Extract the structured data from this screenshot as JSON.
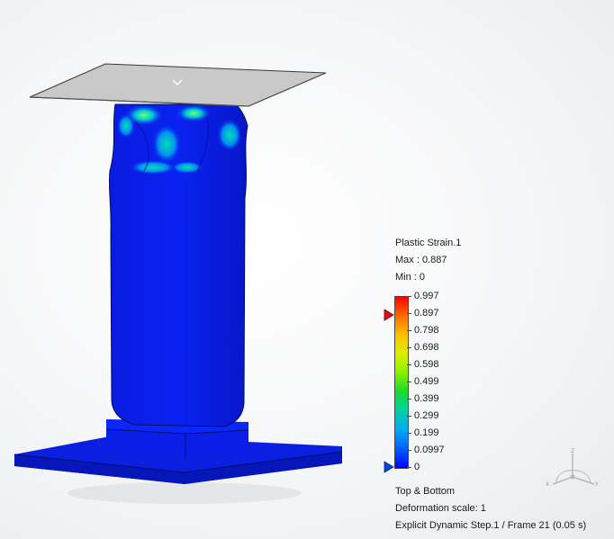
{
  "legend": {
    "title": "Plastic Strain.1",
    "max_text": "Max : 0.887",
    "min_text": "Min : 0",
    "ticks": [
      "0.997",
      "0.897",
      "0.798",
      "0.698",
      "0.598",
      "0.499",
      "0.399",
      "0.299",
      "0.199",
      "0.0997",
      "0"
    ],
    "max_marker_color": "#e01010",
    "min_marker_color": "#1040e0"
  },
  "info": {
    "plot_label": "Top & Bottom",
    "deformation_scale": "Deformation scale: 1",
    "step_frame": "Explicit Dynamic Step.1 / Frame 21 (0.05 s)"
  },
  "triad": {
    "axis_x": "X",
    "axis_y": "Y",
    "axis_z": "Z"
  },
  "colors": {
    "model_blue": "#0a1ee8",
    "plate_gray": "#c7c7c7",
    "base_blue": "#0a1fe0"
  }
}
